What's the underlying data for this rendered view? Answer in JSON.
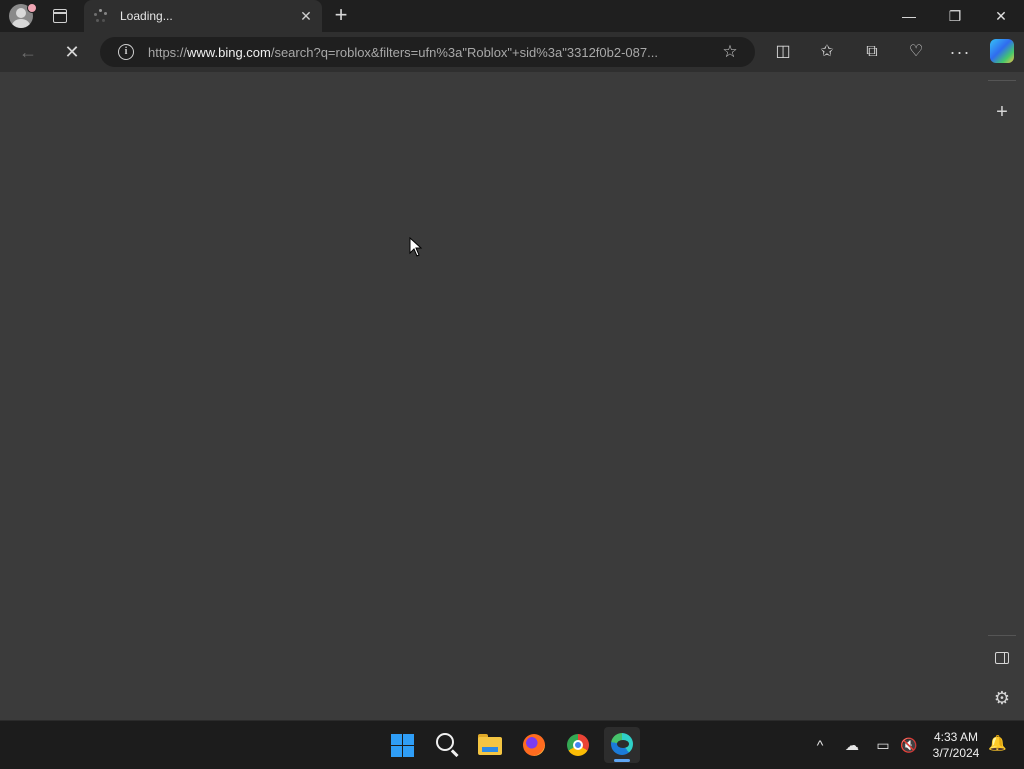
{
  "browser": {
    "tab": {
      "title": "Loading..."
    },
    "address_bar": {
      "url_prefix": "https://",
      "url_host": "www.bing.com",
      "url_rest": "/search?q=roblox&filters=ufn%3a\"Roblox\"+sid%3a\"3312f0b2-087..."
    },
    "window_controls": {
      "minimize": "—",
      "restore": "❐",
      "close": "✕"
    },
    "toolbar_glyphs": {
      "back": "←",
      "stop": "✕",
      "favorite": "☆",
      "split": "◫",
      "favorites": "✩",
      "collections": "⧉",
      "health": "♡",
      "more": "···"
    },
    "sidebar_glyphs": {
      "add": "+",
      "settings": "⚙"
    }
  },
  "taskbar": {
    "tray": {
      "chevron": "^",
      "onedrive": "☁",
      "network": "▭",
      "volume": "🔇"
    },
    "clock": {
      "time": "4:33 AM",
      "date": "3/7/2024"
    },
    "notifications": "🔔"
  },
  "icons": [
    "profile-avatar-icon",
    "tab-actions-icon",
    "loading-spinner-icon",
    "close-icon",
    "plus-icon",
    "back-arrow-icon",
    "stop-icon",
    "info-icon",
    "star-icon",
    "split-screen-icon",
    "favorites-icon",
    "collections-icon",
    "browser-essentials-icon",
    "more-icon",
    "copilot-icon",
    "settings-icon",
    "windows-start-icon",
    "search-icon",
    "file-explorer-icon",
    "firefox-icon",
    "chrome-icon",
    "edge-icon"
  ]
}
